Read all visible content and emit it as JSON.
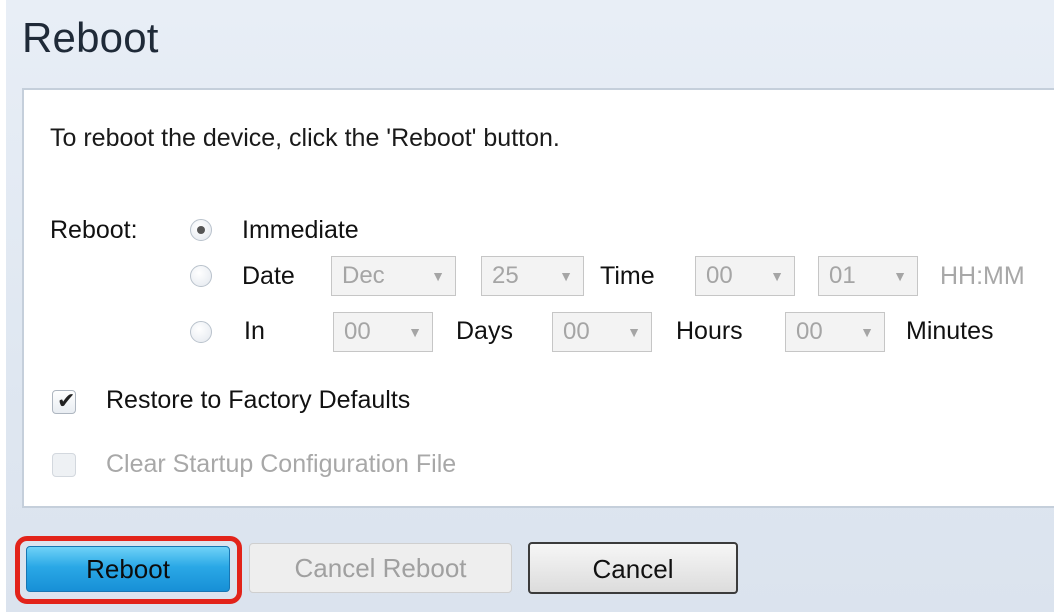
{
  "title": "Reboot",
  "intro": "To reboot the device, click the 'Reboot' button.",
  "reboot_label": "Reboot:",
  "options": {
    "immediate": {
      "label": "Immediate",
      "checked": true
    },
    "date": {
      "label": "Date",
      "checked": false,
      "month": "Dec",
      "day": "25",
      "time_label": "Time",
      "hour": "00",
      "minute": "01",
      "format_hint": "HH:MM"
    },
    "in": {
      "label": "In",
      "checked": false,
      "days": "00",
      "days_label": "Days",
      "hours": "00",
      "hours_label": "Hours",
      "minutes": "00",
      "minutes_label": "Minutes"
    }
  },
  "restore_defaults": {
    "label": "Restore to Factory Defaults",
    "checked": true
  },
  "clear_startup": {
    "label": "Clear Startup Configuration File",
    "checked": false,
    "disabled": true
  },
  "buttons": {
    "reboot": "Reboot",
    "cancel_reboot": "Cancel Reboot",
    "cancel": "Cancel"
  },
  "icons": {
    "dropdown": "chevron-down-icon",
    "check": "checkmark-icon"
  },
  "colors": {
    "highlight": "#e2231a",
    "primary_button": "#2aa8e6"
  }
}
